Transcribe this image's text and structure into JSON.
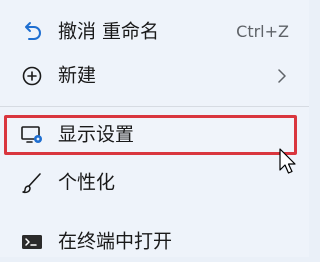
{
  "menu": {
    "items": [
      {
        "label": "撤消 重命名",
        "shortcut": "Ctrl+Z",
        "icon": "undo-icon"
      },
      {
        "label": "新建",
        "icon": "add-circle-icon",
        "submenu_icon": "chevron-right-icon"
      },
      {
        "label": "显示设置",
        "icon": "display-settings-icon"
      },
      {
        "label": "个性化",
        "icon": "paintbrush-icon"
      },
      {
        "label": "在终端中打开",
        "icon": "terminal-icon"
      }
    ],
    "highlighted_item": "显示设置"
  },
  "colors": {
    "menu_background": "#eef3fa",
    "highlight_border": "#d9363e",
    "accent_blue": "#1f6fd1",
    "text": "#1a1a1a"
  }
}
